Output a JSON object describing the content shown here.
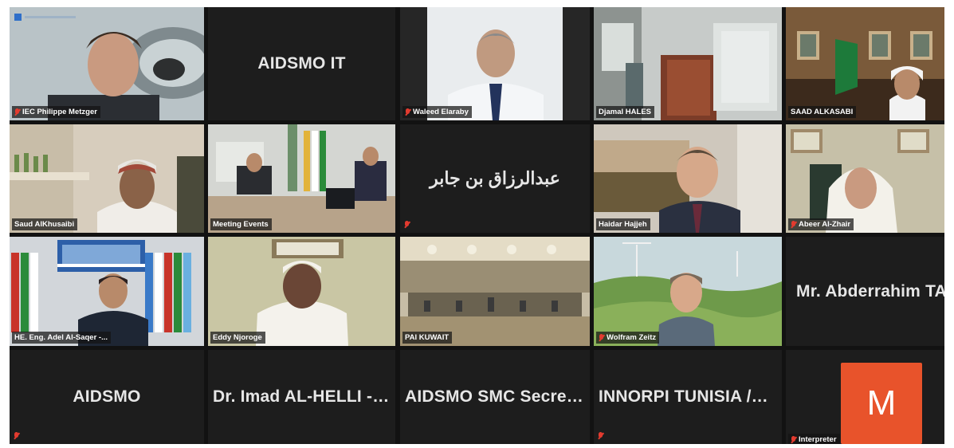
{
  "meeting": {
    "tiles": [
      {
        "id": "philippe",
        "label": "IEC Philippe Metzger",
        "muted": true
      },
      {
        "id": "aidsmo-it",
        "display_name": "AIDSMO IT"
      },
      {
        "id": "waleed",
        "label": "Waleed Elaraby",
        "muted": true
      },
      {
        "id": "djamal",
        "label": "Djamal HALES"
      },
      {
        "id": "saad",
        "label": "SAAD ALKASABI"
      },
      {
        "id": "saud",
        "label": "Saud AlKhusaibi"
      },
      {
        "id": "meeting-events",
        "label": "Meeting Events"
      },
      {
        "id": "arabic",
        "display_name": "عبدالرزاق بن جابر",
        "muted": true
      },
      {
        "id": "haidar",
        "label": "Haidar Hajjeh"
      },
      {
        "id": "abeer",
        "label": "Abeer Al-Zhair",
        "muted": true
      },
      {
        "id": "adel",
        "label": "HE. Eng. Adel Al-Saqer -..."
      },
      {
        "id": "eddy",
        "label": "Eddy Njoroge",
        "active_speaker": true
      },
      {
        "id": "pai",
        "label": "PAI KUWAIT"
      },
      {
        "id": "wolfram",
        "label": "Wolfram Zeitz",
        "muted": true
      },
      {
        "id": "abderrahim",
        "display_name": "Mr. Abderrahim TAI"
      },
      {
        "id": "aidsmo",
        "display_name": "AIDSMO",
        "muted": true
      },
      {
        "id": "imad",
        "display_name": "Dr. Imad AL-HELLI - A..."
      },
      {
        "id": "smc",
        "display_name": "AIDSMO SMC Secret..."
      },
      {
        "id": "innorpi",
        "display_name": "INNORPI TUNISIA /La...",
        "muted": true
      },
      {
        "id": "interpreter",
        "label": "Interpreter",
        "avatar_letter": "M",
        "muted": true
      }
    ]
  },
  "colors": {
    "tile_background": "#1d1d1d",
    "active_speaker_border": "#d8d85a",
    "mute_red": "#e33b2f",
    "avatar_orange": "#e8532b"
  }
}
